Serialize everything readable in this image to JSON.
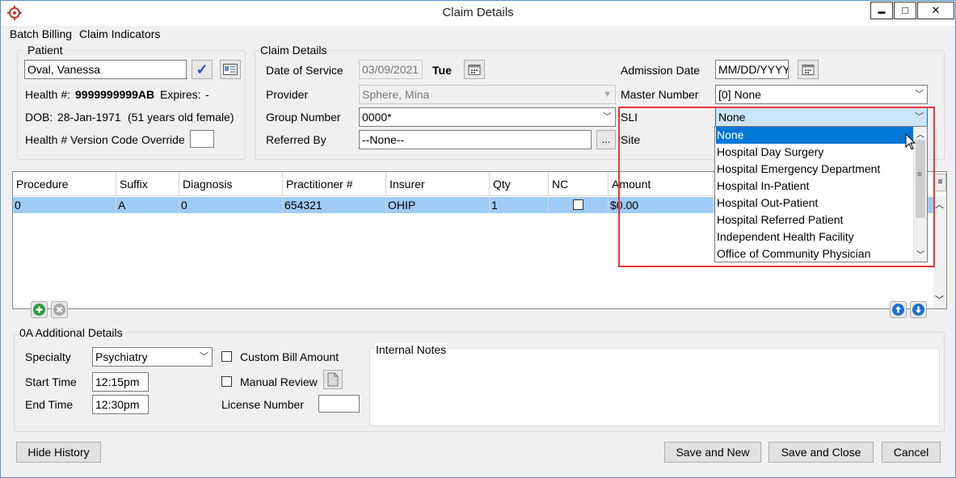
{
  "window": {
    "title": "Claim Details",
    "minimize": "▬",
    "maximize": "□",
    "close": "✕"
  },
  "menu": {
    "items": [
      "Batch Billing",
      "Claim Indicators"
    ]
  },
  "patient": {
    "group_label": "Patient",
    "name": "Oval, Vanessa",
    "health_label": "Health #:",
    "health_value": "9999999999AB",
    "expires_label": "Expires:",
    "expires_value": "-",
    "dob_label": "DOB:",
    "dob_value": "28-Jan-1971",
    "age_text": "(51 years old female)",
    "version_override_label": "Health # Version Code Override",
    "version_override_value": ""
  },
  "claim": {
    "group_label": "Claim Details",
    "date_of_service_label": "Date of Service",
    "date_of_service_value": "03/09/2021",
    "day_of_week": "Tue",
    "provider_label": "Provider",
    "provider_value": "Sphere, Mina",
    "group_number_label": "Group Number",
    "group_number_value": "0000*",
    "referred_by_label": "Referred By",
    "referred_by_value": "--None--",
    "referred_browse": "...",
    "admission_date_label": "Admission Date",
    "admission_date_placeholder": "MM/DD/YYYY",
    "master_number_label": "Master Number",
    "master_number_value": "[0] None",
    "sli_label": "SLI",
    "sli_value": "None",
    "site_label": "Site"
  },
  "sli_dropdown": {
    "options": [
      "None",
      "Hospital Day Surgery",
      "Hospital Emergency Department",
      "Hospital In-Patient",
      "Hospital Out-Patient",
      "Hospital Referred Patient",
      "Independent Health Facility",
      "Office of Community Physician"
    ],
    "selected_index": 0
  },
  "grid": {
    "columns": [
      "Procedure",
      "Suffix",
      "Diagnosis",
      "Practitioner #",
      "Insurer",
      "Qty",
      "NC",
      "Amount"
    ],
    "rows": [
      {
        "procedure": "0",
        "suffix": "A",
        "diagnosis": "0",
        "practitioner": "654321",
        "insurer": "OHIP",
        "qty": "1",
        "nc": false,
        "amount": "$0.00",
        "extra": "$"
      }
    ]
  },
  "additional": {
    "group_label": "0A Additional Details",
    "specialty_label": "Specialty",
    "specialty_value": "Psychiatry",
    "start_time_label": "Start Time",
    "start_time_value": "12:15pm",
    "end_time_label": "End Time",
    "end_time_value": "12:30pm",
    "custom_bill_label": "Custom Bill Amount",
    "manual_review_label": "Manual Review",
    "license_number_label": "License Number",
    "license_number_value": "",
    "internal_notes_label": "Internal Notes"
  },
  "buttons": {
    "hide_history": "Hide History",
    "save_and_new": "Save and New",
    "save_and_close": "Save and Close",
    "cancel": "Cancel"
  },
  "colors": {
    "selection": "#0078d7",
    "row_highlight": "#9ecbf5",
    "annotation": "#e5383b",
    "checkmark": "#1a4fd6",
    "add_green": "#2e9a3a"
  }
}
